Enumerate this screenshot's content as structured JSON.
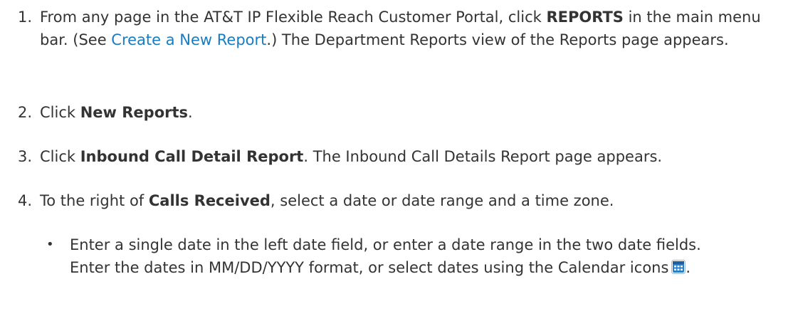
{
  "steps": [
    {
      "number": "1.",
      "segments": [
        {
          "text": "From any page in the AT&T IP Flexible Reach Customer Portal, click ",
          "style": "plain"
        },
        {
          "text": "REPORTS",
          "style": "bold"
        },
        {
          "text": " in the main menu bar. (See ",
          "style": "plain"
        },
        {
          "text": "Create a New Report",
          "style": "link"
        },
        {
          "text": ".) The Department Reports view of the Reports page appears.",
          "style": "plain"
        }
      ]
    },
    {
      "number": "2.",
      "segments": [
        {
          "text": "Click ",
          "style": "plain"
        },
        {
          "text": "New Reports",
          "style": "bold"
        },
        {
          "text": ".",
          "style": "plain"
        }
      ]
    },
    {
      "number": "3.",
      "segments": [
        {
          "text": "Click ",
          "style": "plain"
        },
        {
          "text": "Inbound Call Detail Report",
          "style": "bold"
        },
        {
          "text": ". The Inbound Call Details Report page appears.",
          "style": "plain"
        }
      ]
    },
    {
      "number": "4.",
      "segments": [
        {
          "text": "To the right of ",
          "style": "plain"
        },
        {
          "text": "Calls Received",
          "style": "bold"
        },
        {
          "text": ", select a date or date range and a time zone.",
          "style": "plain"
        }
      ]
    }
  ],
  "bullet": {
    "symbol": "•",
    "line1": "Enter a single date in the left date field, or enter a date range in the two date fields.",
    "line2": "Enter the dates in MM/DD/YYYY format, or select dates using the Calendar icons",
    "line2_end": ".",
    "icon": "calendar-icon"
  },
  "colors": {
    "text": "#333333",
    "link": "#1a7bbf",
    "icon_blue": "#2a7fc9"
  }
}
